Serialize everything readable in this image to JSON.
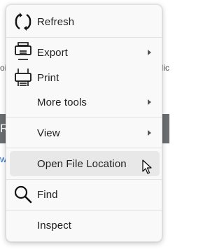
{
  "background": {
    "left_fragment": "oi",
    "right_fragment": "dic",
    "band_letter": "R",
    "link_fragment": "w"
  },
  "menu": {
    "items": [
      {
        "label": "Refresh",
        "icon": "refresh-icon",
        "submenu": false
      },
      {
        "label": "Export",
        "icon": "export-icon",
        "submenu": true
      },
      {
        "label": "Print",
        "icon": "print-icon",
        "submenu": false
      },
      {
        "label": "More tools",
        "icon": "",
        "submenu": true
      },
      {
        "label": "View",
        "icon": "",
        "submenu": true
      },
      {
        "label": "Open File Location",
        "icon": "",
        "submenu": false,
        "highlighted": true
      },
      {
        "label": "Find",
        "icon": "search-icon",
        "submenu": false
      },
      {
        "label": "Inspect",
        "icon": "",
        "submenu": false
      }
    ],
    "highlight_color": "#e8e8e8",
    "background_color": "#f9f9f9"
  }
}
